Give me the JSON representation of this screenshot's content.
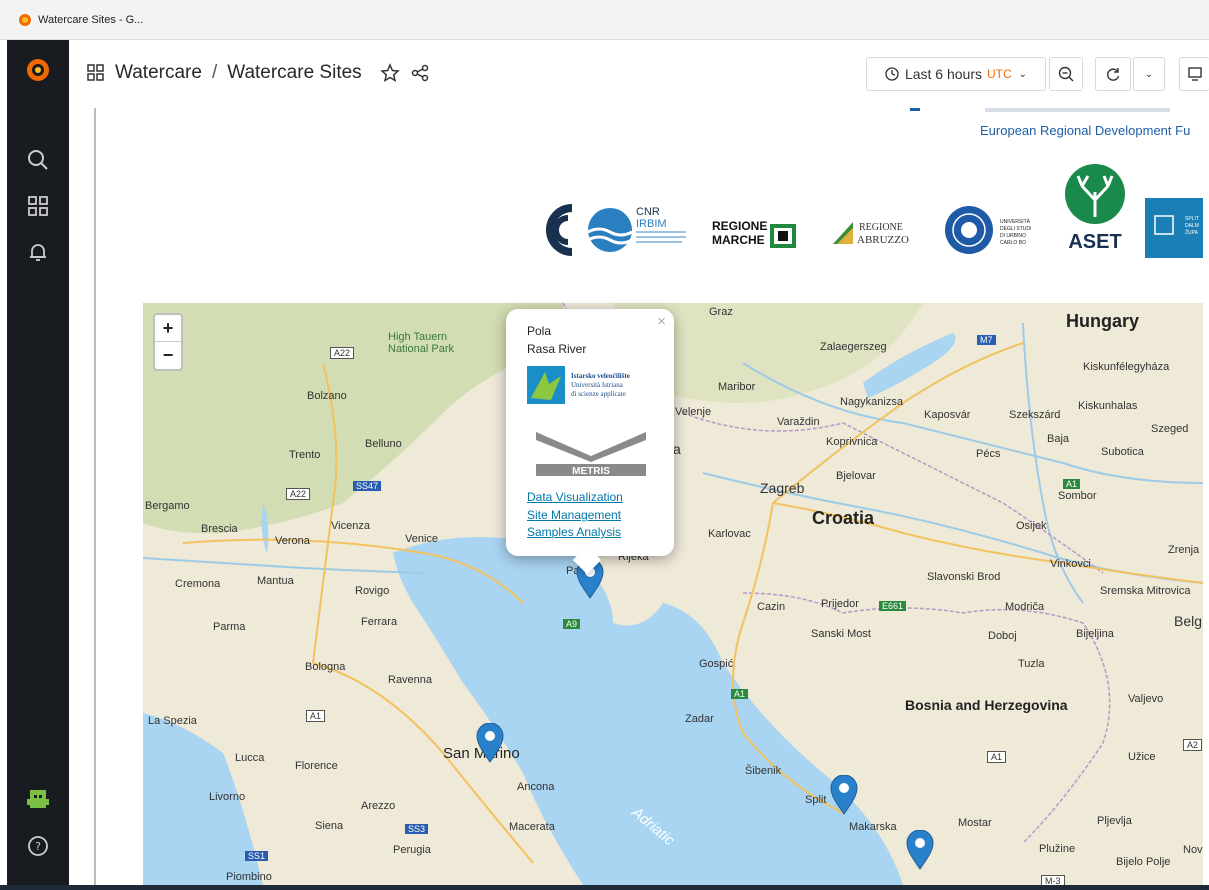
{
  "browser": {
    "tab_title": "Watercare Sites - G..."
  },
  "sidebar": {
    "items": [
      {
        "icon": "grafana-logo-icon"
      },
      {
        "icon": "search-icon"
      },
      {
        "icon": "dashboards-icon"
      },
      {
        "icon": "alert-bell-icon"
      },
      {
        "icon": "user-avatar-icon"
      },
      {
        "icon": "help-icon"
      }
    ]
  },
  "header": {
    "breadcrumb_folder": "Watercare",
    "breadcrumb_separator": "/",
    "breadcrumb_dashboard": "Watercare Sites",
    "time_range_label": "Last 6 hours",
    "timezone": "UTC"
  },
  "banner": {
    "erdf_text": "European Regional Development Fu",
    "logos": {
      "cnr_line1": "CNR",
      "cnr_line2": "IRBIM",
      "regione_marche_1": "REGIONE",
      "regione_marche_2": "MARCHE",
      "regione_abruzzo_1": "REGIONE",
      "regione_abruzzo_2": "ABRUZZO",
      "urbino_1": "UNIVERSITÀ",
      "urbino_2": "DEGLI STUDI",
      "urbino_3": "DI URBINO",
      "urbino_4": "CARLO BO",
      "aset": "ASET",
      "split_1": "SPLIT",
      "split_2": "DALM",
      "split_3": "ŽUPA"
    }
  },
  "map": {
    "zoom_in": "+",
    "zoom_out": "−",
    "popup": {
      "close": "×",
      "title_line1": "Pola",
      "title_line2": "Rasa River",
      "logo1_line1": "Istarsko veleučilište",
      "logo1_line2": "Università Istriana",
      "logo1_line3": "di scienze applicate",
      "logo2": "METRIS",
      "links": [
        "Data Visualization",
        "Site Management",
        "Samples Analysis"
      ]
    },
    "countries": [
      "Hungary",
      "Croatia",
      "Bosnia and Herzegovina"
    ],
    "places": [
      "Graz",
      "Zalaegerszeg",
      "Kiskunfélegyháza",
      "Kiskunhalas",
      "Nagykanizsa",
      "Kaposvár",
      "Szekszárd",
      "Baja",
      "Szeged",
      "Maribor",
      "Velenje",
      "Varaždin",
      "Koprivnica",
      "Pécs",
      "Subotica",
      "Bjelovar",
      "Zagreb",
      "Sombor",
      "Osijek",
      "Karlovac",
      "Vinkovci",
      "Zrenja",
      "Slavonski Brod",
      "Sremska Mitrovica",
      "Cazin",
      "Prijedor",
      "Modriča",
      "Belg",
      "Sanski Most",
      "Doboj",
      "Bijeljina",
      "Tuzla",
      "Gospić",
      "Valjevo",
      "Zadar",
      "Užice",
      "Šibenik",
      "Split",
      "Makarska",
      "Mostar",
      "Pljevlja",
      "Bijelo Polje",
      "Nov",
      "Plužine",
      "Bolzano",
      "Trento",
      "Belluno",
      "Bergamo",
      "Brescia",
      "Vicenza",
      "Verona",
      "Venice",
      "Cremona",
      "Mantua",
      "Rovigo",
      "Parma",
      "Ferrara",
      "Bologna",
      "Ravenna",
      "La Spezia",
      "San Marino",
      "Lucca",
      "Florence",
      "Livorno",
      "Arezzo",
      "Siena",
      "Ancona",
      "Macerata",
      "Perugia",
      "Piombino",
      "Rijeka",
      "High Tauern National Park",
      "Adriatic",
      "Pa",
      "a"
    ],
    "roads": [
      "A22",
      "A22",
      "SS47",
      "A9",
      "A1",
      "A1",
      "A1",
      "A2",
      "E661",
      "A1",
      "M7",
      "SS3",
      "SS1",
      "M-3"
    ]
  },
  "colors": {
    "sidebar_bg": "#181b1f",
    "accent_orange": "#f46800",
    "link": "#0078a8",
    "marker": "#2a81cb",
    "sea": "#a9d4f2",
    "land": "#efe9d8"
  }
}
